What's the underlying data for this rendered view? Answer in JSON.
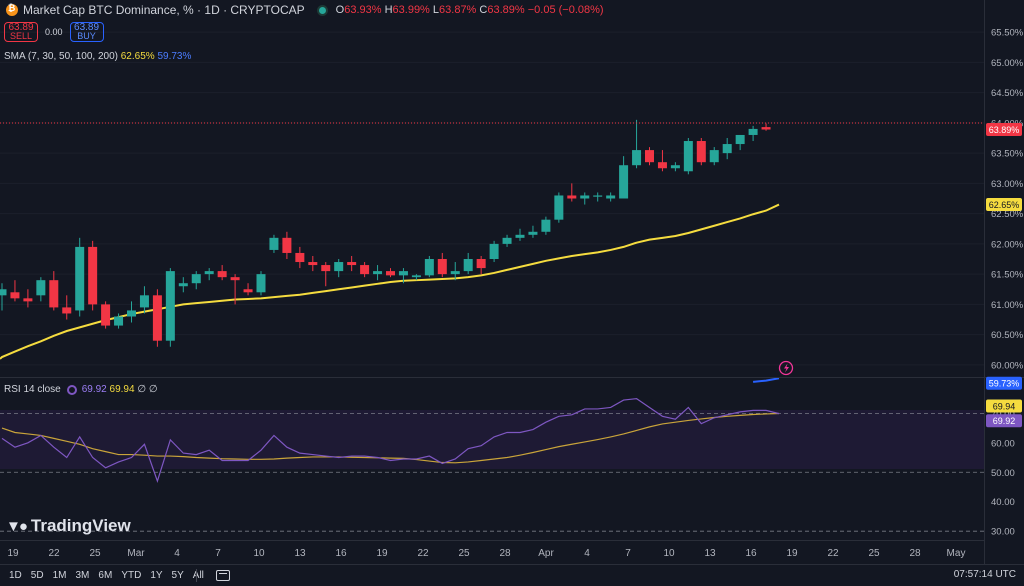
{
  "header": {
    "symbol": "Market Cap BTC Dominance, % · 1D · CRYPTOCAP",
    "o_label": "O",
    "o_value": "63.93%",
    "h_label": "H",
    "h_value": "63.99%",
    "l_label": "L",
    "l_value": "63.87%",
    "c_label": "C",
    "c_value": "63.89%",
    "change": "−0.05 (−0.08%)"
  },
  "trade": {
    "sell_price": "63.89",
    "sell_label": "SELL",
    "spread": "0.00",
    "buy_price": "63.89",
    "buy_label": "BUY"
  },
  "sma_legend": {
    "label": "SMA (7, 30, 50, 100, 200)",
    "value1": "62.65%",
    "value2": "59.73%"
  },
  "rsi_legend": {
    "label": "RSI 14 close",
    "value1": "69.92",
    "value2": "69.94",
    "value3": "∅",
    "value4": "∅"
  },
  "watermark": "TradingView",
  "range_buttons": [
    "1D",
    "5D",
    "1M",
    "3M",
    "6M",
    "YTD",
    "1Y",
    "5Y",
    "All"
  ],
  "clock": "07:57:14 UTC",
  "colors": {
    "up": "#26a69a",
    "down": "#f23645",
    "sma": "#f5dc3f",
    "rsi": "#7e57c2",
    "rsi_ma": "#c9a43a",
    "bg": "#131722"
  },
  "chart_data": {
    "type": "candlestick",
    "price_ticks": [
      "65.50%",
      "65.00%",
      "64.50%",
      "64.00%",
      "63.50%",
      "63.00%",
      "62.50%",
      "62.00%",
      "61.50%",
      "61.00%",
      "60.50%",
      "60.00%"
    ],
    "price_range": [
      59.8,
      65.7
    ],
    "x_labels": [
      "19",
      "22",
      "25",
      "Mar",
      "4",
      "7",
      "10",
      "13",
      "16",
      "19",
      "22",
      "25",
      "28",
      "Apr",
      "4",
      "7",
      "10",
      "13",
      "16",
      "19",
      "22",
      "25",
      "28",
      "May"
    ],
    "current_price": "63.89%",
    "sma_label_value": "62.65%",
    "sma2_label_value": "59.73%",
    "candles": [
      {
        "o": 61.15,
        "h": 61.35,
        "l": 60.9,
        "c": 61.25
      },
      {
        "o": 61.2,
        "h": 61.4,
        "l": 61.05,
        "c": 61.1
      },
      {
        "o": 61.1,
        "h": 61.25,
        "l": 60.95,
        "c": 61.05
      },
      {
        "o": 61.15,
        "h": 61.45,
        "l": 61.05,
        "c": 61.4
      },
      {
        "o": 61.4,
        "h": 61.55,
        "l": 60.9,
        "c": 60.95
      },
      {
        "o": 60.95,
        "h": 61.15,
        "l": 60.75,
        "c": 60.85
      },
      {
        "o": 60.9,
        "h": 62.1,
        "l": 60.8,
        "c": 61.95
      },
      {
        "o": 61.95,
        "h": 62.05,
        "l": 60.9,
        "c": 61.0
      },
      {
        "o": 61.0,
        "h": 61.05,
        "l": 60.6,
        "c": 60.65
      },
      {
        "o": 60.65,
        "h": 60.85,
        "l": 60.6,
        "c": 60.8
      },
      {
        "o": 60.8,
        "h": 61.05,
        "l": 60.7,
        "c": 60.9
      },
      {
        "o": 60.95,
        "h": 61.3,
        "l": 60.85,
        "c": 61.15
      },
      {
        "o": 61.15,
        "h": 61.25,
        "l": 60.3,
        "c": 60.4
      },
      {
        "o": 60.4,
        "h": 61.6,
        "l": 60.3,
        "c": 61.55
      },
      {
        "o": 61.3,
        "h": 61.45,
        "l": 61.2,
        "c": 61.35
      },
      {
        "o": 61.35,
        "h": 61.55,
        "l": 61.25,
        "c": 61.5
      },
      {
        "o": 61.5,
        "h": 61.6,
        "l": 61.4,
        "c": 61.55
      },
      {
        "o": 61.55,
        "h": 61.65,
        "l": 61.4,
        "c": 61.45
      },
      {
        "o": 61.45,
        "h": 61.5,
        "l": 61.0,
        "c": 61.4
      },
      {
        "o": 61.25,
        "h": 61.35,
        "l": 61.15,
        "c": 61.2
      },
      {
        "o": 61.2,
        "h": 61.55,
        "l": 61.15,
        "c": 61.5
      },
      {
        "o": 61.9,
        "h": 62.15,
        "l": 61.85,
        "c": 62.1
      },
      {
        "o": 62.1,
        "h": 62.2,
        "l": 61.75,
        "c": 61.85
      },
      {
        "o": 61.85,
        "h": 61.95,
        "l": 61.6,
        "c": 61.7
      },
      {
        "o": 61.7,
        "h": 61.8,
        "l": 61.55,
        "c": 61.65
      },
      {
        "o": 61.65,
        "h": 61.7,
        "l": 61.3,
        "c": 61.55
      },
      {
        "o": 61.55,
        "h": 61.75,
        "l": 61.45,
        "c": 61.7
      },
      {
        "o": 61.7,
        "h": 61.8,
        "l": 61.55,
        "c": 61.65
      },
      {
        "o": 61.65,
        "h": 61.7,
        "l": 61.45,
        "c": 61.5
      },
      {
        "o": 61.5,
        "h": 61.65,
        "l": 61.4,
        "c": 61.55
      },
      {
        "o": 61.55,
        "h": 61.6,
        "l": 61.45,
        "c": 61.48
      },
      {
        "o": 61.48,
        "h": 61.6,
        "l": 61.35,
        "c": 61.55
      },
      {
        "o": 61.45,
        "h": 61.5,
        "l": 61.4,
        "c": 61.48
      },
      {
        "o": 61.48,
        "h": 61.8,
        "l": 61.45,
        "c": 61.75
      },
      {
        "o": 61.75,
        "h": 61.85,
        "l": 61.45,
        "c": 61.5
      },
      {
        "o": 61.5,
        "h": 61.7,
        "l": 61.4,
        "c": 61.55
      },
      {
        "o": 61.55,
        "h": 61.85,
        "l": 61.5,
        "c": 61.75
      },
      {
        "o": 61.75,
        "h": 61.8,
        "l": 61.5,
        "c": 61.6
      },
      {
        "o": 61.75,
        "h": 62.05,
        "l": 61.7,
        "c": 62.0
      },
      {
        "o": 62.0,
        "h": 62.15,
        "l": 61.95,
        "c": 62.1
      },
      {
        "o": 62.1,
        "h": 62.25,
        "l": 62.05,
        "c": 62.15
      },
      {
        "o": 62.15,
        "h": 62.3,
        "l": 62.1,
        "c": 62.2
      },
      {
        "o": 62.2,
        "h": 62.45,
        "l": 62.15,
        "c": 62.4
      },
      {
        "o": 62.4,
        "h": 62.85,
        "l": 62.35,
        "c": 62.8
      },
      {
        "o": 62.8,
        "h": 63.0,
        "l": 62.7,
        "c": 62.75
      },
      {
        "o": 62.75,
        "h": 62.85,
        "l": 62.65,
        "c": 62.8
      },
      {
        "o": 62.78,
        "h": 62.85,
        "l": 62.7,
        "c": 62.8
      },
      {
        "o": 62.75,
        "h": 62.85,
        "l": 62.7,
        "c": 62.8
      },
      {
        "o": 62.75,
        "h": 63.45,
        "l": 62.75,
        "c": 63.3
      },
      {
        "o": 63.3,
        "h": 64.05,
        "l": 63.25,
        "c": 63.55
      },
      {
        "o": 63.55,
        "h": 63.6,
        "l": 63.3,
        "c": 63.35
      },
      {
        "o": 63.35,
        "h": 63.55,
        "l": 63.2,
        "c": 63.25
      },
      {
        "o": 63.25,
        "h": 63.35,
        "l": 63.2,
        "c": 63.3
      },
      {
        "o": 63.2,
        "h": 63.75,
        "l": 63.15,
        "c": 63.7
      },
      {
        "o": 63.7,
        "h": 63.75,
        "l": 63.3,
        "c": 63.35
      },
      {
        "o": 63.35,
        "h": 63.6,
        "l": 63.3,
        "c": 63.55
      },
      {
        "o": 63.5,
        "h": 63.75,
        "l": 63.4,
        "c": 63.65
      },
      {
        "o": 63.65,
        "h": 63.8,
        "l": 63.55,
        "c": 63.8
      },
      {
        "o": 63.8,
        "h": 63.95,
        "l": 63.7,
        "c": 63.9
      },
      {
        "o": 63.93,
        "h": 63.99,
        "l": 63.87,
        "c": 63.89
      }
    ],
    "sma": [
      60.13,
      60.22,
      60.31,
      60.39,
      60.48,
      60.56,
      60.62,
      60.68,
      60.74,
      60.79,
      60.84,
      60.88,
      60.92,
      60.96,
      61.0,
      61.02,
      61.04,
      61.06,
      61.08,
      61.09,
      61.1,
      61.12,
      61.14,
      61.16,
      61.19,
      61.22,
      61.25,
      61.28,
      61.31,
      61.34,
      61.37,
      61.39,
      61.4,
      61.41,
      61.42,
      61.43,
      61.45,
      61.48,
      61.52,
      61.57,
      61.62,
      61.67,
      61.72,
      61.76,
      61.8,
      61.83,
      61.86,
      61.9,
      61.95,
      62.02,
      62.07,
      62.1,
      62.13,
      62.18,
      62.24,
      62.3,
      62.36,
      62.42,
      62.49,
      62.55,
      62.65
    ],
    "sma2": [
      {
        "i": 58,
        "v": 59.72
      },
      {
        "i": 59,
        "v": 59.74
      },
      {
        "i": 60,
        "v": 59.78
      }
    ],
    "rsi_ticks": [
      "80.00",
      "70.00",
      "60.00",
      "50.00",
      "40.00",
      "30.00"
    ],
    "rsi_range": [
      27,
      82
    ],
    "rsi_levels": [
      70,
      50,
      30
    ],
    "rsi": [
      61.5,
      58.5,
      60.0,
      62.5,
      58.5,
      55.0,
      62.0,
      55.0,
      51.5,
      53.5,
      55.0,
      59.5,
      47.0,
      61.0,
      56.5,
      56.0,
      57.5,
      54.0,
      54.0,
      54.0,
      57.5,
      62.5,
      58.5,
      56.5,
      56.0,
      55.5,
      55.0,
      55.5,
      55.5,
      55.0,
      54.0,
      54.5,
      54.5,
      55.5,
      53.0,
      54.5,
      58.0,
      59.0,
      62.0,
      63.5,
      63.5,
      64.5,
      67.0,
      69.0,
      69.5,
      71.5,
      71.5,
      72.0,
      74.5,
      75.0,
      72.0,
      69.0,
      68.0,
      72.0,
      66.5,
      68.5,
      69.5,
      70.5,
      71.0,
      71.0,
      69.9
    ],
    "rsi_ma": [
      65.0,
      63.5,
      63.0,
      62.5,
      61.5,
      60.5,
      59.5,
      58.0,
      57.0,
      56.0,
      56.0,
      55.8,
      55.5,
      55.5,
      55.3,
      55.0,
      54.8,
      54.6,
      54.5,
      54.4,
      54.4,
      54.5,
      54.8,
      55.0,
      55.2,
      55.2,
      55.2,
      55.1,
      55.0,
      54.9,
      54.8,
      54.7,
      54.3,
      53.8,
      53.3,
      53.2,
      53.5,
      54.0,
      54.5,
      55.0,
      55.8,
      56.7,
      57.7,
      58.7,
      59.5,
      60.3,
      61.1,
      62.0,
      63.0,
      64.2,
      65.4,
      66.4,
      67.0,
      67.6,
      68.1,
      68.6,
      69.0,
      69.3,
      69.6,
      69.8,
      69.94
    ]
  }
}
